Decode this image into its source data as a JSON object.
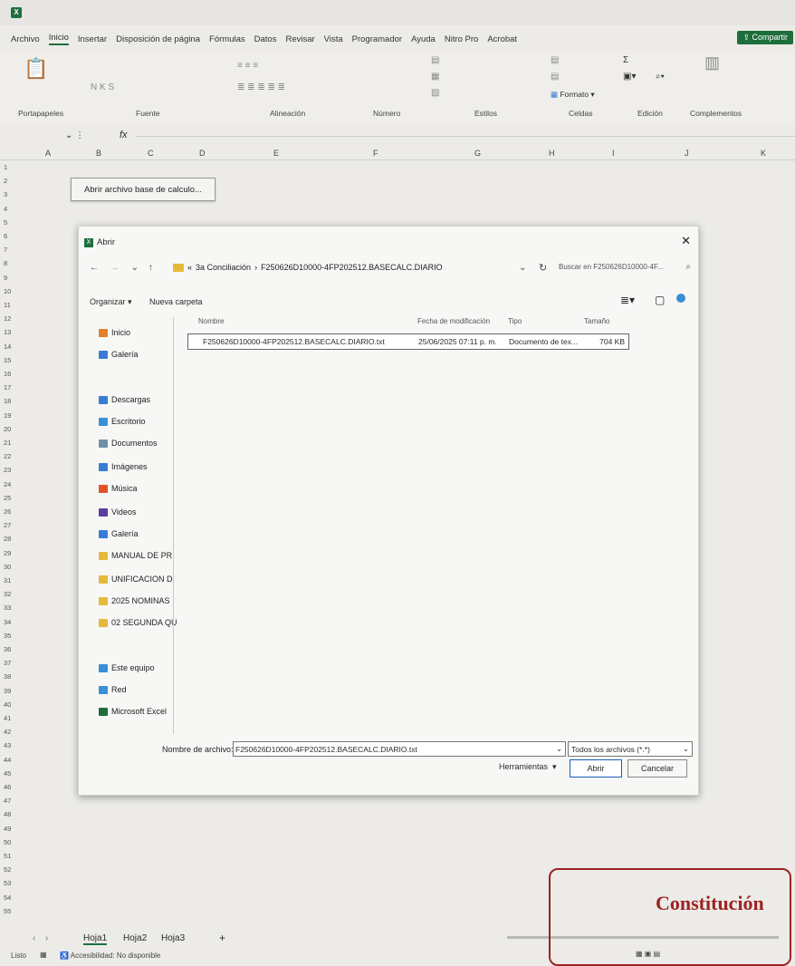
{
  "menu": [
    "Archivo",
    "Inicio",
    "Insertar",
    "Disposición de página",
    "Fórmulas",
    "Datos",
    "Revisar",
    "Vista",
    "Programador",
    "Ayuda",
    "Nitro Pro",
    "Acrobat"
  ],
  "menu_active_index": 1,
  "share_label": "Compartir",
  "ribbon_groups": [
    {
      "label": "Portapapeles"
    },
    {
      "label": "Fuente"
    },
    {
      "label": "Alineación"
    },
    {
      "label": "Número"
    },
    {
      "label": "Estilos"
    },
    {
      "label": "Celdas"
    },
    {
      "label": "Edición"
    },
    {
      "label": "Complementos"
    }
  ],
  "ribbon_format_label": "Formato",
  "formula_symbol": "fx",
  "columns": [
    "A",
    "B",
    "C",
    "D",
    "E",
    "F",
    "G",
    "H",
    "I",
    "J",
    "K"
  ],
  "rows": [
    "1",
    "2",
    "3",
    "4",
    "5",
    "6",
    "7",
    "8",
    "9",
    "10",
    "11",
    "12",
    "13",
    "14",
    "15",
    "16",
    "17",
    "18",
    "19",
    "20",
    "21",
    "22",
    "23",
    "24",
    "25",
    "26",
    "27",
    "28",
    "29",
    "30",
    "31",
    "32",
    "33",
    "34",
    "35",
    "36",
    "37",
    "38",
    "39",
    "40",
    "41",
    "42",
    "43",
    "44",
    "45",
    "46",
    "47",
    "48",
    "49",
    "50",
    "51",
    "52",
    "53",
    "54",
    "55"
  ],
  "sheet_button_label": "Abrir archivo base de calculo...",
  "dialog": {
    "title": "Abrir",
    "close_glyph": "✕",
    "breadcrumb_prefix": "«",
    "breadcrumb": [
      "3a Conciliación",
      "F250626D10000-4FP202512.BASECALC.DIARIO"
    ],
    "search_placeholder": "Buscar en F250626D10000-4F...",
    "organize_label": "Organizar",
    "new_folder_label": "Nueva carpeta",
    "sidebar": [
      {
        "label": "Inicio",
        "icon": "home-icon",
        "color": "#e2812c"
      },
      {
        "label": "Galería",
        "icon": "gallery-icon",
        "color": "#3a7bd5"
      },
      {
        "label": "Descargas",
        "icon": "download-icon",
        "color": "#3a7bd5"
      },
      {
        "label": "Escritorio",
        "icon": "desktop-icon",
        "color": "#3a8fd5"
      },
      {
        "label": "Documentos",
        "icon": "document-icon",
        "color": "#6e8fa8"
      },
      {
        "label": "Imágenes",
        "icon": "image-icon",
        "color": "#3a7bd5"
      },
      {
        "label": "Música",
        "icon": "music-icon",
        "color": "#e2532c"
      },
      {
        "label": "Videos",
        "icon": "video-icon",
        "color": "#5a3fa0"
      },
      {
        "label": "Galería",
        "icon": "gallery-icon",
        "color": "#3a7bd5"
      },
      {
        "label": "MANUAL DE PR",
        "icon": "folder-icon",
        "color": "#e7b93b"
      },
      {
        "label": "UNIFICACION D",
        "icon": "folder-icon",
        "color": "#e7b93b"
      },
      {
        "label": "2025 NOMINAS",
        "icon": "folder-icon",
        "color": "#e7b93b"
      },
      {
        "label": "02 SEGUNDA QU",
        "icon": "folder-icon",
        "color": "#e7b93b"
      },
      {
        "label": "Este equipo",
        "icon": "computer-icon",
        "color": "#3a8fd5"
      },
      {
        "label": "Red",
        "icon": "network-icon",
        "color": "#3a8fd5"
      },
      {
        "label": "Microsoft Excel",
        "icon": "excel-icon",
        "color": "#1e6e3c"
      }
    ],
    "headers": {
      "name": "Nombre",
      "date": "Fecha de modificación",
      "type": "Tipo",
      "size": "Tamaño"
    },
    "files": [
      {
        "name": "F250626D10000-4FP202512.BASECALC.DIARIO.txt",
        "date": "25/06/2025 07:11 p. m.",
        "type": "Documento de tex...",
        "size": "704 KB"
      }
    ],
    "filename_label": "Nombre de archivo:",
    "filename_value": "F250626D10000-4FP202512.BASECALC.DIARIO.txt",
    "filetype_value": "Todos los archivos (*.*)",
    "tools_label": "Herramientas",
    "open_label": "Abrir",
    "cancel_label": "Cancelar"
  },
  "sheet_tabs": [
    "Hoja1",
    "Hoja2",
    "Hoja3"
  ],
  "add_sheet": "+",
  "status": {
    "ready": "Listo",
    "accessibility": "Accesibilidad: No disponible"
  },
  "stamp_text": "Constitución"
}
